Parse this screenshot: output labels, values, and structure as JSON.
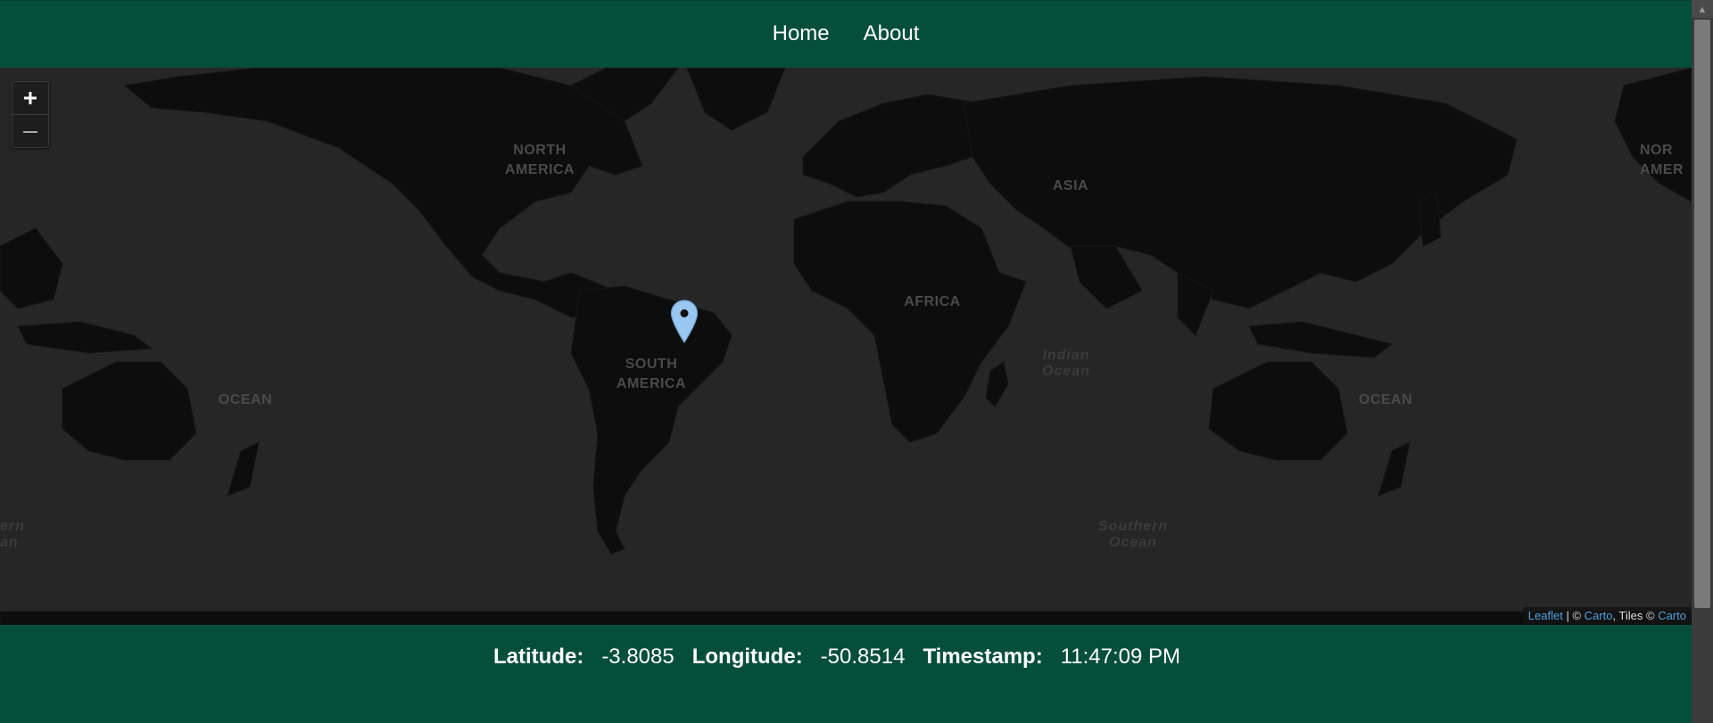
{
  "nav": {
    "home": "Home",
    "about": "About"
  },
  "map": {
    "zoom_in": "+",
    "zoom_out": "–",
    "continents": [
      "NORTH AMERICA",
      "ASIA",
      "AFRICA",
      "SOUTH AMERICA",
      "OCEAN",
      "OCEAN",
      "NOR AMER"
    ],
    "oceans": [
      "Indian Ocean",
      "Southern Ocean",
      "ern an"
    ],
    "marker": {
      "latitude": -3.8085,
      "longitude": -50.8514,
      "color": "#9ac6f2"
    },
    "attribution": {
      "leaflet": "Leaflet",
      "sep1": " | © ",
      "carto1": "Carto",
      "sep2": ", Tiles © ",
      "carto2": "Carto"
    }
  },
  "footer": {
    "latitude_label": "Latitude:",
    "latitude_value": "-3.8085",
    "longitude_label": "Longitude:",
    "longitude_value": "-50.8514",
    "timestamp_label": "Timestamp:",
    "timestamp_value": "11:47:09 PM"
  },
  "colors": {
    "brand": "#054e3c",
    "ocean": "#262626",
    "land": "#0c0c0c",
    "link": "#4fa3e0"
  }
}
